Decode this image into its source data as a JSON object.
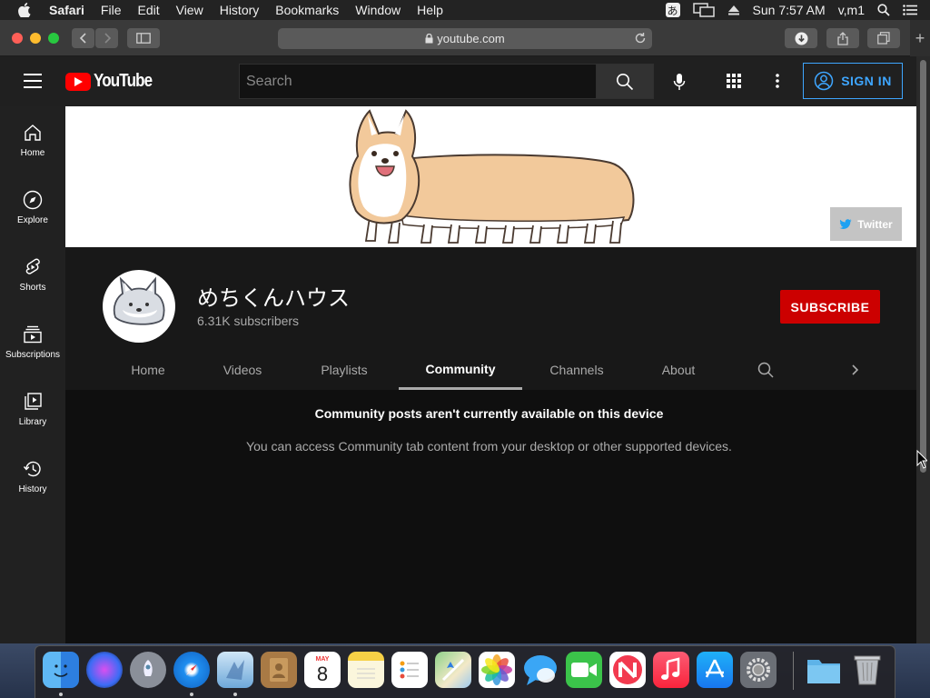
{
  "menubar": {
    "items": [
      "Safari",
      "File",
      "Edit",
      "View",
      "History",
      "Bookmarks",
      "Window",
      "Help"
    ],
    "input_indicator": "あ",
    "clock": "Sun 7:57 AM",
    "user": "v,m1"
  },
  "browser": {
    "url": "youtube.com"
  },
  "youtube": {
    "logo_text": "YouTube",
    "search_placeholder": "Search",
    "signin_label": "SIGN IN",
    "guide": [
      {
        "label": "Home",
        "icon": "home-icon"
      },
      {
        "label": "Explore",
        "icon": "compass-icon"
      },
      {
        "label": "Shorts",
        "icon": "shorts-icon"
      },
      {
        "label": "Subscriptions",
        "icon": "subscriptions-icon"
      },
      {
        "label": "Library",
        "icon": "library-icon"
      },
      {
        "label": "History",
        "icon": "history-icon"
      }
    ],
    "banner_link": "Twitter",
    "channel": {
      "name": "めちくんハウス",
      "subscribers": "6.31K subscribers",
      "subscribe_label": "SUBSCRIBE"
    },
    "tabs": [
      "Home",
      "Videos",
      "Playlists",
      "Community",
      "Channels",
      "About"
    ],
    "active_tab": "Community",
    "message_title": "Community posts aren't currently available on this device",
    "message_body": "You can access Community tab content from your desktop or other supported devices."
  },
  "dock": {
    "apps": [
      "Finder",
      "Siri",
      "Launchpad",
      "Safari",
      "Mail",
      "Contacts",
      "Calendar",
      "Notes",
      "Reminders",
      "Maps",
      "Photos",
      "Messages",
      "FaceTime",
      "News",
      "Music",
      "App Store",
      "System Preferences",
      "Downloads",
      "Trash"
    ],
    "calendar_month": "MAY",
    "calendar_day": "8"
  },
  "colors": {
    "youtube_red": "#ff0000",
    "subscribe_red": "#cc0000",
    "link_blue": "#3ea6ff",
    "page_bg": "#181818"
  }
}
